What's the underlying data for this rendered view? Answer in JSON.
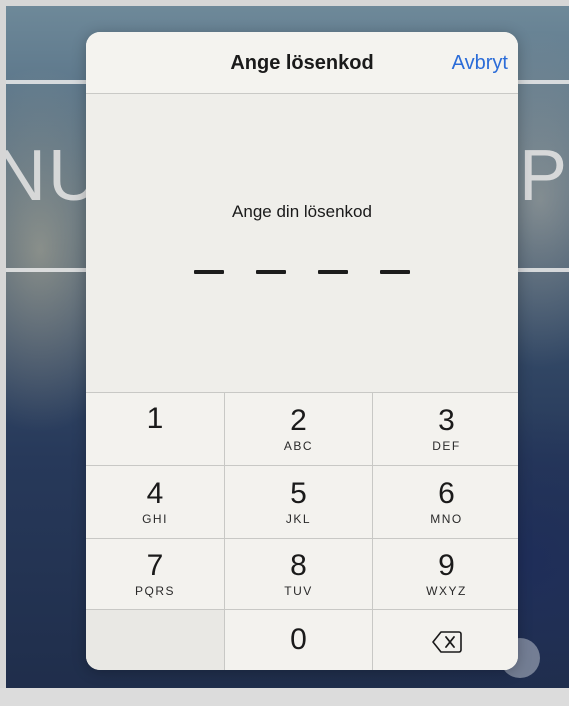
{
  "header": {
    "title": "Ange lösenkod",
    "cancel_label": "Avbryt"
  },
  "prompt": {
    "text": "Ange din lösenkod",
    "pin_length": 4,
    "entered_digits": 0
  },
  "background": {
    "left_letters": "NU",
    "right_letters": "P"
  },
  "keypad": {
    "keys": [
      {
        "digit": "1",
        "letters": ""
      },
      {
        "digit": "2",
        "letters": "ABC"
      },
      {
        "digit": "3",
        "letters": "DEF"
      },
      {
        "digit": "4",
        "letters": "GHI"
      },
      {
        "digit": "5",
        "letters": "JKL"
      },
      {
        "digit": "6",
        "letters": "MNO"
      },
      {
        "digit": "7",
        "letters": "PQRS"
      },
      {
        "digit": "8",
        "letters": "TUV"
      },
      {
        "digit": "9",
        "letters": "WXYZ"
      },
      {
        "digit": "0",
        "letters": ""
      }
    ],
    "delete_icon": "delete-backspace-icon"
  },
  "colors": {
    "accent": "#2b6cd8",
    "modal_bg": "#f2f2ef",
    "text": "#1a1a1a"
  }
}
